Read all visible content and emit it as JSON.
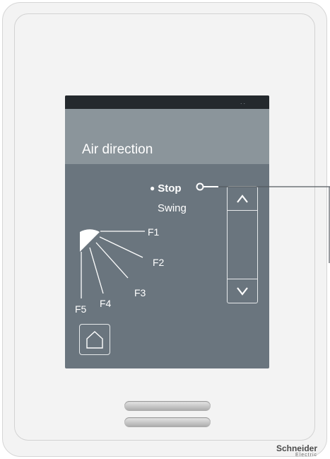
{
  "screen": {
    "status_dots": "..",
    "title": "Air direction",
    "options": [
      {
        "label": "Stop",
        "selected": true
      },
      {
        "label": "Swing",
        "selected": false
      }
    ],
    "fan_positions": [
      "F1",
      "F2",
      "F3",
      "F4",
      "F5"
    ],
    "scroll": {
      "up_icon": "chevron-up-icon",
      "down_icon": "chevron-down-icon"
    },
    "home_icon": "home-icon"
  },
  "device": {
    "brand": "Schneider",
    "brand_sub": "Electric"
  },
  "colors": {
    "screen_bg": "#6a757e",
    "title_bar": "#8b959b",
    "status_bar": "#24292d",
    "device_body": "#f3f3f3"
  }
}
